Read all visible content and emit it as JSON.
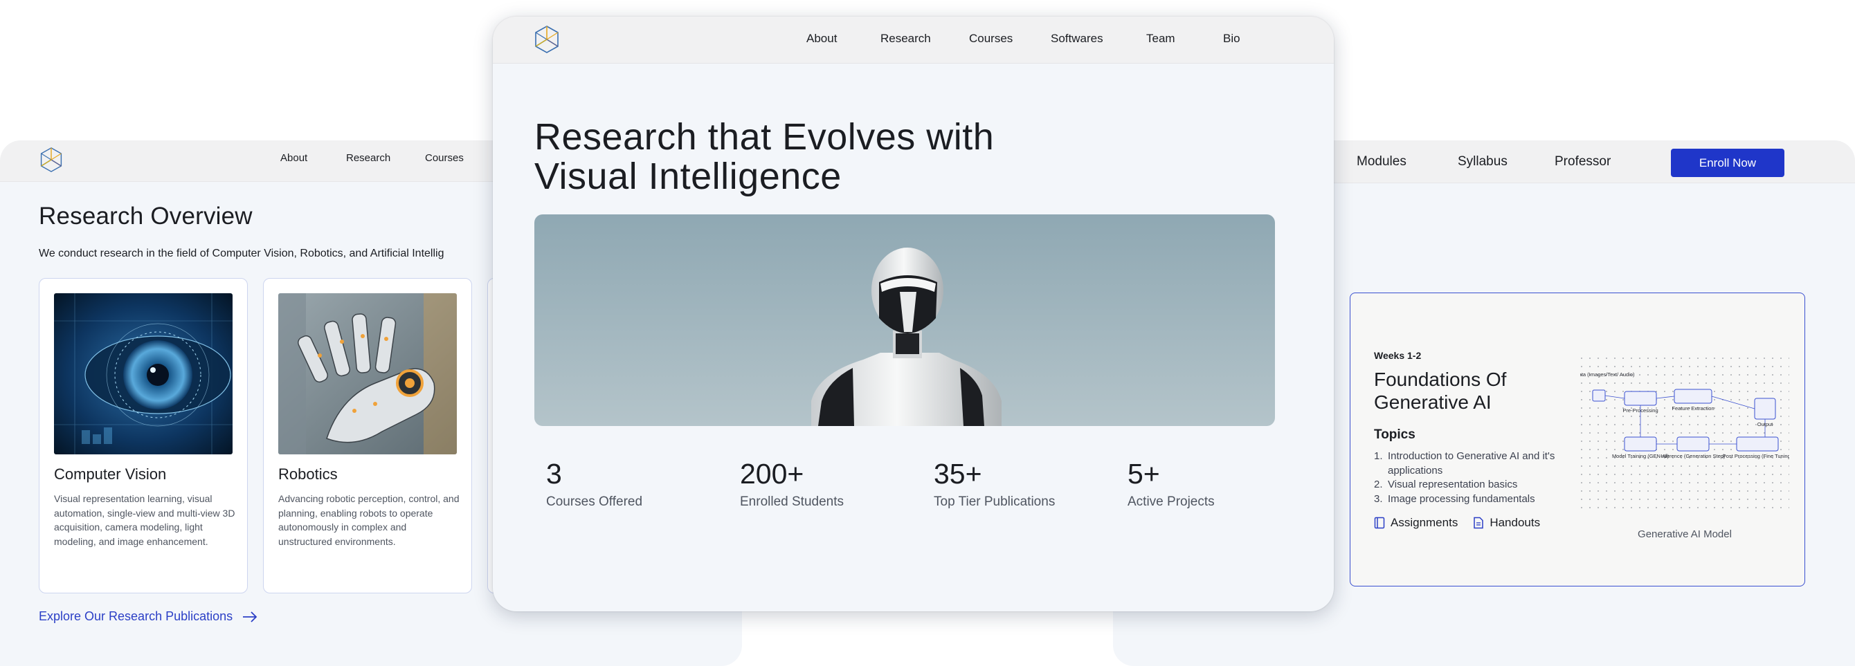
{
  "left": {
    "nav": [
      "About",
      "Research",
      "Courses"
    ],
    "title": "Research Overview",
    "intro": "We conduct research in the field of Computer Vision, Robotics, and Artificial Intellig",
    "cards": [
      {
        "title": "Computer Vision",
        "desc": "Visual representation learning, visual automation, single-view and multi-view 3D acquisition, camera modeling, light modeling, and image enhancement."
      },
      {
        "title": "Robotics",
        "desc": "Advancing robotic perception, control, and planning, enabling robots to operate autonomously in complex and unstructured environments."
      }
    ],
    "explore_label": "Explore Our Research Publications"
  },
  "center": {
    "nav": [
      "About",
      "Research",
      "Courses",
      "Softwares",
      "Team",
      "Bio"
    ],
    "title_line1": "Research that Evolves with",
    "title_line2": "Visual Intelligence",
    "stats": [
      {
        "value": "3",
        "label": "Courses Offered"
      },
      {
        "value": "200+",
        "label": "Enrolled Students"
      },
      {
        "value": "35+",
        "label": "Top Tier Publications"
      },
      {
        "value": "5+",
        "label": "Active Projects"
      }
    ]
  },
  "right": {
    "nav": [
      "Modules",
      "Syllabus",
      "Professor"
    ],
    "enroll_label": "Enroll Now",
    "module": {
      "weeks": "Weeks 1-2",
      "title": "Foundations Of Generative AI",
      "topics_heading": "Topics",
      "topics": [
        "Introduction to Generative AI and it's applications",
        "Visual representation basics",
        "Image processing fundamentals"
      ],
      "links": [
        "Assignments",
        "Handouts"
      ],
      "diagram_caption": "Generative AI Model",
      "diagram_labels": {
        "input": "Input Data (Images/Text/ Audio)",
        "pre": "Pre-Processing",
        "feature": "Feature Extraction",
        "output": "Output",
        "training": "Model Training (GEN-AI)",
        "inference": "Inference (Generation Step)",
        "post": "Post Processing (Fine Tuning)"
      }
    }
  },
  "colors": {
    "accent": "#1f36c9",
    "panel_bg": "#f3f6fa",
    "nav_bg": "#f1f1f2"
  },
  "icons": [
    "logo-icon",
    "arrow-right-icon",
    "book-icon",
    "document-icon"
  ]
}
